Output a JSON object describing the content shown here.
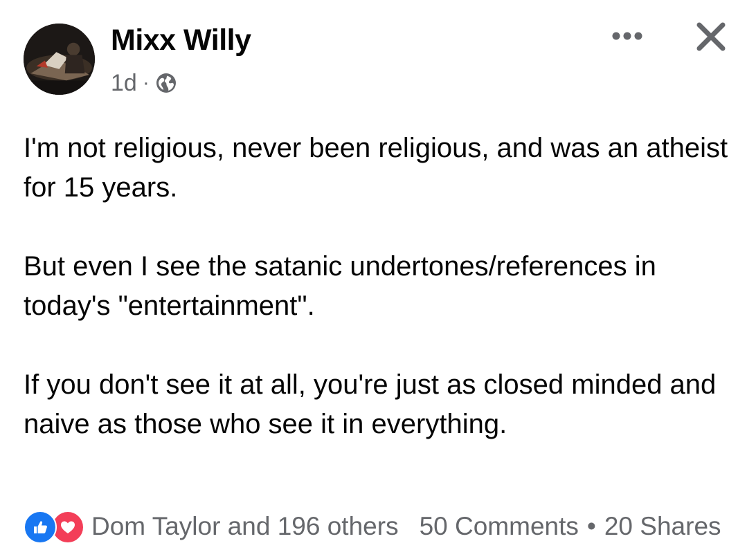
{
  "post": {
    "author": "Mixx Willy",
    "time": "1d",
    "separator": "·",
    "audience_icon": "globe-icon",
    "paragraphs": [
      "I'm not religious, never been religious, and was an atheist for 15 years.",
      "But even I see the satanic undertones/references in today's \"entertainment\".",
      "If you don't see it at all, you're just as closed minded and naive as those who see it in everything."
    ]
  },
  "header_actions": {
    "more_icon": "more-dots-icon",
    "close_icon": "close-icon"
  },
  "footer": {
    "reaction_icons": [
      "like-icon",
      "love-icon"
    ],
    "reactors": "Dom Taylor and 196 others",
    "comments": "50 Comments",
    "separator": "•",
    "shares": "20 Shares"
  },
  "colors": {
    "text_primary": "#050505",
    "text_secondary": "#65676b",
    "like_blue": "#1877f2",
    "love_red": "#f33e58"
  }
}
